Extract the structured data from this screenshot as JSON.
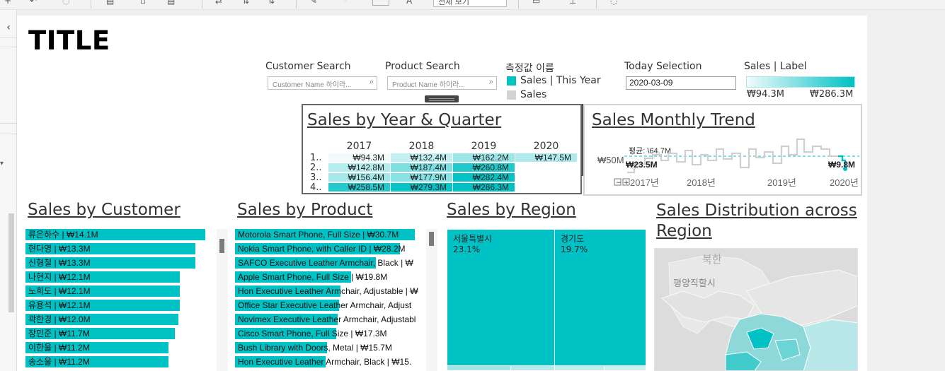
{
  "toolbar": {
    "view_select": "전체 보기"
  },
  "dashboard": {
    "title": "TITLE"
  },
  "filters": {
    "customer_label": "Customer Search",
    "customer_placeholder": "Customer Name 하이라...",
    "product_label": "Product Search",
    "product_placeholder": "Product Name 하이라...",
    "measure_legend_title": "측정값 이름",
    "measure_items": [
      "Sales | This Year",
      "Sales"
    ],
    "today_label": "Today Selection",
    "today_value": "2020-03-09",
    "sales_label_title": "Sales | Label",
    "sales_label_min": "₩94.3M",
    "sales_label_max": "₩286.3M"
  },
  "colors": {
    "teal": "#00c1c4",
    "gray": "#d3d3d3"
  },
  "year_quarter": {
    "title": "Sales by Year & Quarter",
    "years": [
      "2017",
      "2018",
      "2019",
      "2020"
    ],
    "quarters": [
      "1..",
      "2..",
      "3..",
      "4.."
    ],
    "cells": [
      [
        "₩94.3M",
        "₩132.4M",
        "₩162.2M",
        "₩147.5M"
      ],
      [
        "₩142.8M",
        "₩187.4M",
        "₩260.8M",
        ""
      ],
      [
        "₩156.4M",
        "₩177.9M",
        "₩282.4M",
        ""
      ],
      [
        "₩258.5M",
        "₩279.3M",
        "₩286.3M",
        ""
      ]
    ],
    "values": [
      [
        94.3,
        132.4,
        162.2,
        147.5
      ],
      [
        142.8,
        187.4,
        260.8,
        null
      ],
      [
        156.4,
        177.9,
        282.4,
        null
      ],
      [
        258.5,
        279.3,
        286.3,
        null
      ]
    ]
  },
  "monthly_trend": {
    "title": "Sales Monthly Trend",
    "avg_label": "평균: \\64.7M",
    "axis_label": "₩50M",
    "start_value": "₩23.5M",
    "end_value": "₩9.8M",
    "x_labels": [
      "2017년",
      "2018년",
      "2019년",
      "2020년"
    ]
  },
  "customers": {
    "title": "Sales by Customer",
    "rows": [
      {
        "label": "류은하수 | ₩14.1M",
        "value": 14.1
      },
      {
        "label": "현다영 | ₩13.3M",
        "value": 13.3
      },
      {
        "label": "신형철 | ₩13.3M",
        "value": 13.3
      },
      {
        "label": "나현지 | ₩12.1M",
        "value": 12.1
      },
      {
        "label": "노희도 | ₩12.1M",
        "value": 12.1
      },
      {
        "label": "유용석 | ₩12.1M",
        "value": 12.1
      },
      {
        "label": "곽한경 | ₩12.0M",
        "value": 12.0
      },
      {
        "label": "장민준 | ₩11.7M",
        "value": 11.7
      },
      {
        "label": "이한울 | ₩11.2M",
        "value": 11.2
      },
      {
        "label": "송소울 | ₩11.2M",
        "value": 11.2
      }
    ]
  },
  "products": {
    "title": "Sales by Product",
    "rows": [
      {
        "label": "Motorola Smart Phone, Full Size | ₩30.7M",
        "value": 30.7
      },
      {
        "label": "Nokia Smart Phone, with Caller ID | ₩28.2M",
        "value": 28.2
      },
      {
        "label": "SAFCO Executive Leather Armchair, Black | ₩",
        "value": 24.0
      },
      {
        "label": "Apple Smart Phone, Full Size | ₩19.8M",
        "value": 19.8
      },
      {
        "label": "Hon Executive Leather Armchair, Adjustable | ₩",
        "value": 18.0
      },
      {
        "label": "Office Star Executive Leather Armchair, Adjust",
        "value": 17.8
      },
      {
        "label": "Novimex Executive Leather Armchair, Adjustabl",
        "value": 17.5
      },
      {
        "label": "Cisco Smart Phone, Full Size | ₩17.3M",
        "value": 17.3
      },
      {
        "label": "Bush Library with Doors, Metal | ₩15.7M",
        "value": 15.7
      },
      {
        "label": "Hon Executive Leather Armchair, Black | ₩15.",
        "value": 15.5
      }
    ]
  },
  "regions": {
    "title": "Sales by Region",
    "tiles": [
      {
        "name": "서울특별시",
        "pct": "23.1%"
      },
      {
        "name": "경기도",
        "pct": "19.7%"
      }
    ]
  },
  "distribution": {
    "title": "Sales Distribution across Region",
    "map_labels": [
      "북한",
      "평양직할시"
    ]
  }
}
